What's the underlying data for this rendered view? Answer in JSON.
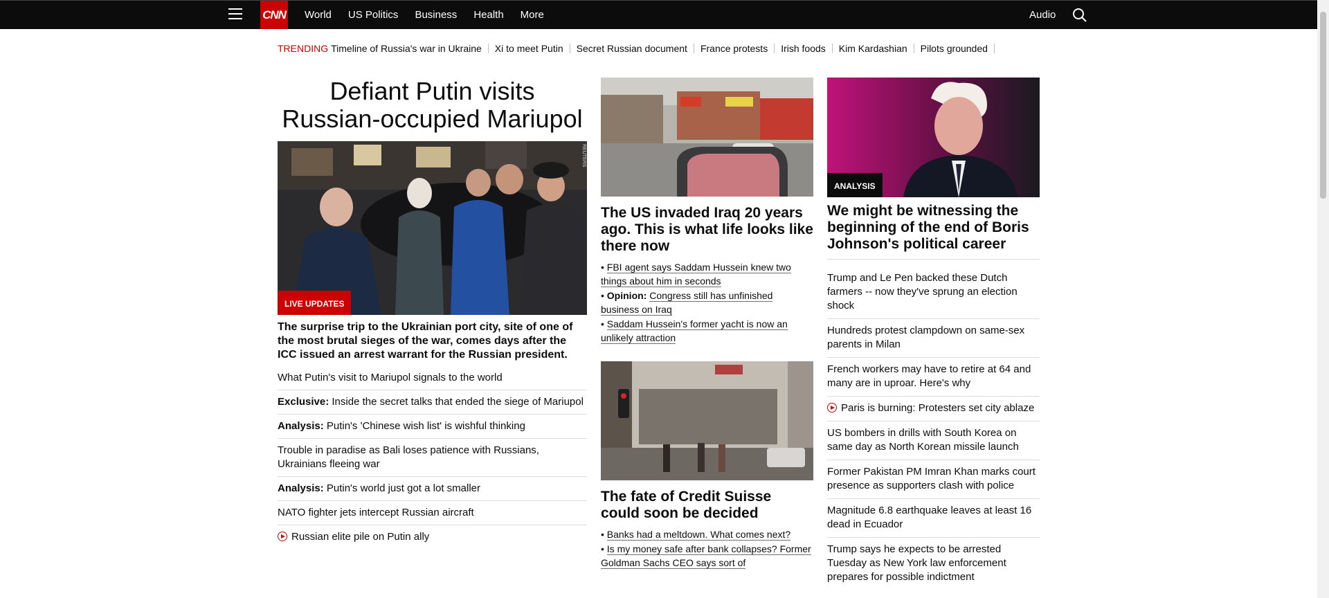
{
  "nav": {
    "logo": "CNN",
    "links": [
      "World",
      "US Politics",
      "Business",
      "Health",
      "More"
    ],
    "audio": "Audio"
  },
  "trending": {
    "label": "TRENDING",
    "items": [
      "Timeline of Russia's war in Ukraine",
      "Xi to meet Putin",
      "Secret Russian document",
      "France protests",
      "Irish foods",
      "Kim Kardashian",
      "Pilots grounded"
    ]
  },
  "col1": {
    "headline": "Defiant Putin visits Russian-occupied Mariupol",
    "badge": "LIVE UPDATES",
    "watermark": "REUTERS",
    "lede": "The surprise trip to the Ukrainian port city, site of one of the most brutal sieges of the war, comes days after the ICC issued an arrest warrant for the Russian president.",
    "items": [
      {
        "prefix": "",
        "text": "What Putin's visit to Mariupol signals to the world"
      },
      {
        "prefix": "Exclusive:",
        "text": " Inside the secret talks that ended the siege of Mariupol"
      },
      {
        "prefix": "Analysis:",
        "text": " Putin's 'Chinese wish list' is wishful thinking"
      },
      {
        "prefix": "",
        "text": "Trouble in paradise as Bali loses patience with Russians, Ukrainians fleeing war"
      },
      {
        "prefix": "Analysis:",
        "text": " Putin's world just got a lot smaller"
      },
      {
        "prefix": "",
        "text": "NATO fighter jets intercept Russian aircraft"
      },
      {
        "prefix": "",
        "text": "Russian elite pile on Putin ally"
      }
    ]
  },
  "col2": {
    "story1": {
      "headline": "The US invaded Iraq 20 years ago. This is what life looks like there now",
      "subs": [
        {
          "prefix": "",
          "text": "FBI agent says Saddam Hussein knew two things about him in seconds"
        },
        {
          "prefix": "Opinion:",
          "text": "Congress still has unfinished business on Iraq"
        },
        {
          "prefix": "",
          "text": "Saddam Hussein's former yacht is now an unlikely attraction"
        }
      ]
    },
    "story2": {
      "headline": "The fate of Credit Suisse could soon be decided",
      "subs": [
        {
          "prefix": "",
          "text": "Banks had a meltdown. What comes next?"
        },
        {
          "prefix": "",
          "text": "Is my money safe after bank collapses? Former Goldman Sachs CEO says sort of"
        }
      ]
    }
  },
  "col3": {
    "badge": "ANALYSIS",
    "headline": "We might be witnessing the beginning of the end of Boris Johnson's political career",
    "items": [
      "Trump and Le Pen backed these Dutch farmers -- now they've sprung an election shock",
      "Hundreds protest clampdown on same-sex parents in Milan",
      "French workers may have to retire at 64 and many are in uproar. Here's why",
      "Paris is burning: Protesters set city ablaze",
      "US bombers in drills with South Korea on same day as North Korean missile launch",
      "Former Pakistan PM Imran Khan marks court presence as supporters clash with police",
      "Magnitude 6.8 earthquake leaves at least 16 dead in Ecuador",
      "Trump says he expects to be arrested Tuesday as New York law enforcement prepares for possible indictment"
    ]
  },
  "colors": {
    "brand": "#cc0000",
    "nav_bg": "#0c0c0c",
    "text": "#0c0c0c"
  }
}
